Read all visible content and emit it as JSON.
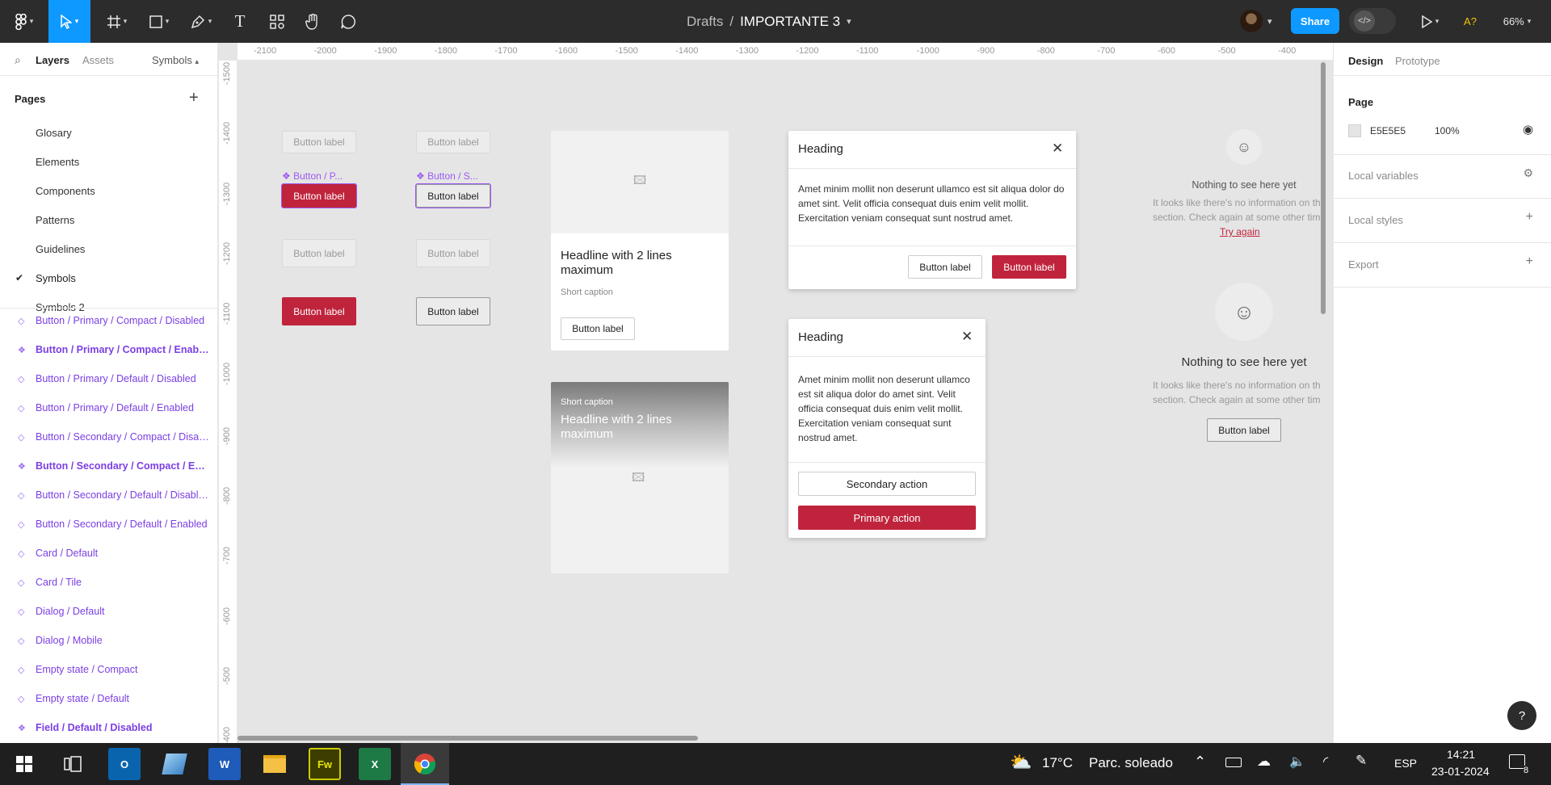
{
  "topbar": {
    "breadcrumb_root": "Drafts",
    "separator": "/",
    "file_name": "IMPORTANTE 3",
    "share_label": "Share",
    "devmode_glyph": "</>",
    "font_warning": "A?",
    "zoom": "66%"
  },
  "left_panel": {
    "tabs": {
      "layers": "Layers",
      "assets": "Assets",
      "symbols": "Symbols"
    },
    "pages_title": "Pages",
    "pages": [
      "Glosary",
      "Elements",
      "Components",
      "Patterns",
      "Guidelines",
      "Symbols",
      "Symbols 2"
    ],
    "current_page": "Symbols",
    "layers": [
      {
        "label": "Button / Primary / Compact / Disabled",
        "bold": false
      },
      {
        "label": "Button / Primary / Compact / Enabled",
        "bold": true
      },
      {
        "label": "Button / Primary / Default / Disabled",
        "bold": false
      },
      {
        "label": "Button / Primary / Default / Enabled",
        "bold": false
      },
      {
        "label": "Button / Secondary / Compact / Disabled",
        "bold": false
      },
      {
        "label": "Button / Secondary / Compact / Enabled",
        "bold": true
      },
      {
        "label": "Button / Secondary / Default / Disabled",
        "bold": false
      },
      {
        "label": "Button / Secondary / Default / Enabled",
        "bold": false
      },
      {
        "label": "Card / Default",
        "bold": false
      },
      {
        "label": "Card / Tile",
        "bold": false
      },
      {
        "label": "Dialog / Default",
        "bold": false
      },
      {
        "label": "Dialog / Mobile",
        "bold": false
      },
      {
        "label": "Empty state / Compact",
        "bold": false
      },
      {
        "label": "Empty state / Default",
        "bold": false
      },
      {
        "label": "Field / Default / Disabled",
        "bold": true
      }
    ]
  },
  "rulers": {
    "horizontal": [
      "-2100",
      "-2000",
      "-1900",
      "-1800",
      "-1700",
      "-1600",
      "-1500",
      "-1400",
      "-1300",
      "-1200",
      "-1100",
      "-1000",
      "-900",
      "-800",
      "-700",
      "-600",
      "-500",
      "-400"
    ],
    "vertical": [
      "-1500",
      "-1400",
      "-1300",
      "-1200",
      "-1100",
      "-1000",
      "-900",
      "-800",
      "-700",
      "-600",
      "-500",
      "-400"
    ]
  },
  "canvas": {
    "button_label": "Button label",
    "comp_label_primary": "Button / P...",
    "comp_label_secondary": "Button / S...",
    "card": {
      "headline": "Headline with 2 lines maximum",
      "caption": "Short caption",
      "button": "Button label"
    },
    "tile": {
      "caption": "Short caption",
      "headline": "Headline with 2 lines maximum"
    },
    "dialog": {
      "heading": "Heading",
      "body": "Amet minim mollit non deserunt ullamco est sit aliqua dolor do amet sint. Velit officia consequat duis enim velit mollit. Exercitation veniam consequat sunt nostrud amet.",
      "secondary": "Button label",
      "primary": "Button label"
    },
    "dialog_mobile": {
      "heading": "Heading",
      "body": "Amet minim mollit non deserunt ullamco est sit aliqua dolor do amet sint. Velit officia consequat duis enim velit mollit. Exercitation veniam consequat sunt nostrud amet.",
      "secondary": "Secondary action",
      "primary": "Primary action"
    },
    "empty_compact": {
      "title": "Nothing to see here yet",
      "desc_line1": "It looks like there's no information on th",
      "desc_line2": "section. Check again at some other tim",
      "link": "Try again"
    },
    "empty_default": {
      "title": "Nothing to see here yet",
      "desc_line1": "It looks like there's no information on th",
      "desc_line2": "section. Check again at some other tim",
      "button": "Button label"
    }
  },
  "right_panel": {
    "tabs": {
      "design": "Design",
      "prototype": "Prototype"
    },
    "page_title": "Page",
    "page_color": "E5E5E5",
    "page_opacity": "100%",
    "local_variables": "Local variables",
    "local_styles": "Local styles",
    "export": "Export"
  },
  "help": "?",
  "taskbar": {
    "weather_temp": "17°C",
    "weather_desc": "Parc. soleado",
    "language": "ESP",
    "time": "14:21",
    "date": "23-01-2024",
    "notifications": "8"
  },
  "colors": {
    "accent": "#0d99ff",
    "brand_red": "#c0243c",
    "component_purple": "#7b3fe4"
  }
}
